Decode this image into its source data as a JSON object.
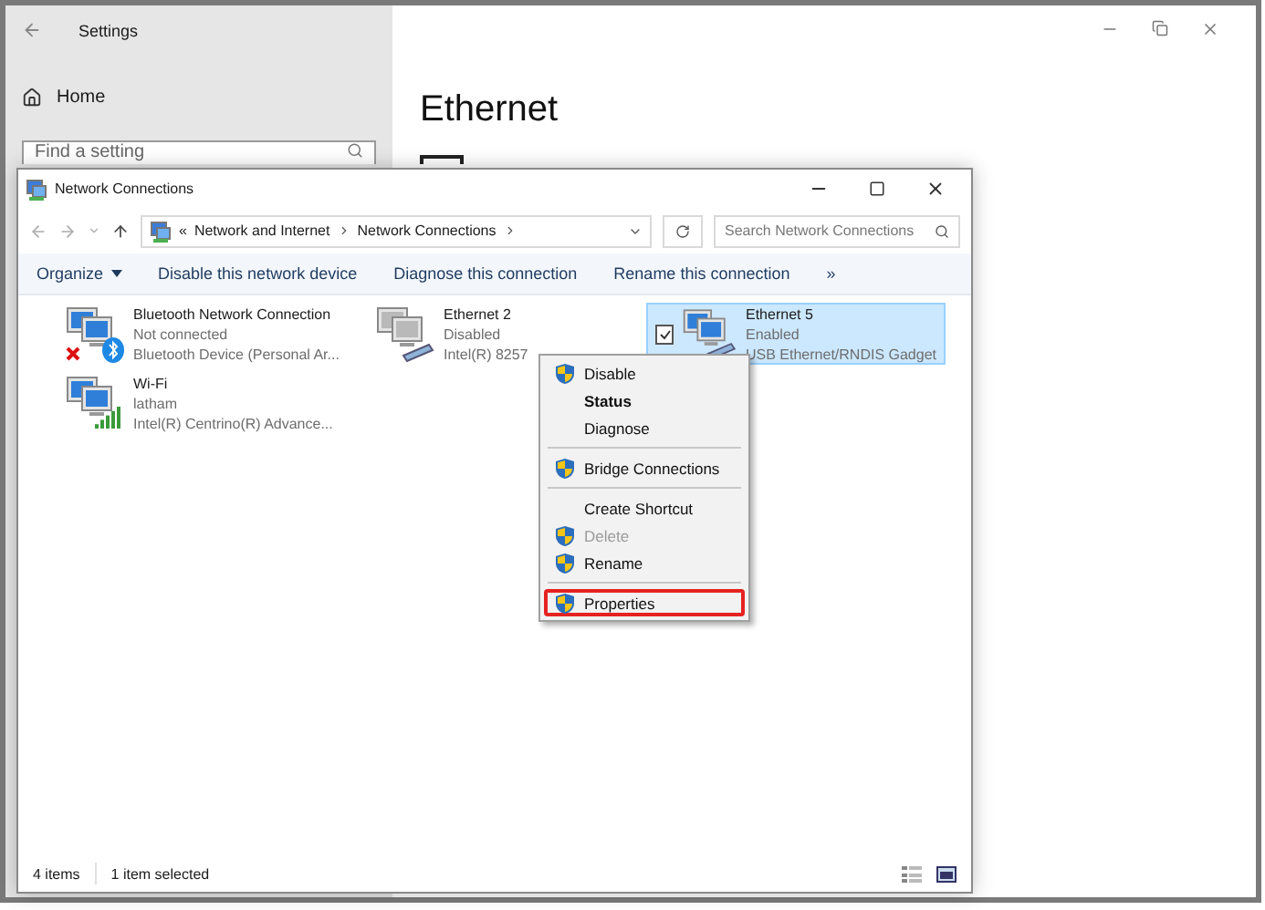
{
  "settings": {
    "title": "Settings",
    "home": "Home",
    "search": {
      "placeholder": "Find a setting"
    },
    "heading": "Ethernet"
  },
  "explorer": {
    "title": "Network Connections",
    "address": {
      "overflow": "«",
      "segments": [
        "Network and Internet",
        "Network Connections"
      ]
    },
    "search": {
      "placeholder": "Search Network Connections"
    },
    "commands": [
      {
        "label": "Organize",
        "kind": "menu"
      },
      {
        "label": "Disable this network device",
        "kind": "plain"
      },
      {
        "label": "Diagnose this connection",
        "kind": "plain"
      },
      {
        "label": "Rename this connection",
        "kind": "plain"
      }
    ],
    "more": "»",
    "connections": [
      {
        "name": "Bluetooth Network Connection",
        "status": "Not connected",
        "device": "Bluetooth Device (Personal Ar...",
        "kind": "bluetooth",
        "error": true,
        "disabled": false,
        "selected": false
      },
      {
        "name": "Ethernet 2",
        "status": "Disabled",
        "device": "Intel(R) 8257",
        "kind": "ethernet",
        "error": false,
        "disabled": true,
        "selected": false
      },
      {
        "name": "Ethernet 5",
        "status": "Enabled",
        "device": "USB Ethernet/RNDIS Gadget",
        "kind": "ethernet",
        "error": false,
        "disabled": false,
        "selected": true
      },
      {
        "name": "Wi-Fi",
        "status": "latham",
        "device": "Intel(R) Centrino(R) Advance...",
        "kind": "wifi",
        "error": false,
        "disabled": false,
        "selected": false
      }
    ],
    "context_menu": [
      [
        {
          "label": "Disable",
          "shield": true,
          "bold": false,
          "disabled": false,
          "highlighted": false
        },
        {
          "label": "Status",
          "shield": false,
          "bold": true,
          "disabled": false,
          "highlighted": false
        },
        {
          "label": "Diagnose",
          "shield": false,
          "bold": false,
          "disabled": false,
          "highlighted": false
        }
      ],
      [
        {
          "label": "Bridge Connections",
          "shield": true,
          "bold": false,
          "disabled": false,
          "highlighted": false
        }
      ],
      [
        {
          "label": "Create Shortcut",
          "shield": false,
          "bold": false,
          "disabled": false,
          "highlighted": false
        },
        {
          "label": "Delete",
          "shield": true,
          "bold": false,
          "disabled": true,
          "highlighted": false
        },
        {
          "label": "Rename",
          "shield": true,
          "bold": false,
          "disabled": false,
          "highlighted": false
        }
      ],
      [
        {
          "label": "Properties",
          "shield": true,
          "bold": false,
          "disabled": false,
          "highlighted": true
        }
      ]
    ],
    "status_bar": [
      "4 items",
      "1 item selected"
    ]
  }
}
